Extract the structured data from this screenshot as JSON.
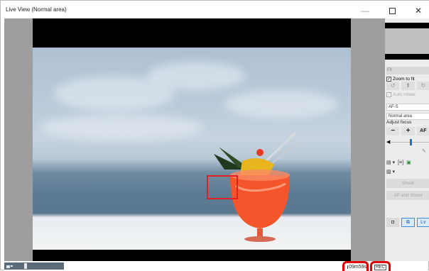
{
  "window": {
    "title": "Live View (Normal area)",
    "minimize_glyph": "—",
    "close_glyph": "✕"
  },
  "status": {
    "timer": "09m59s",
    "rec_label": "REC"
  },
  "panel": {
    "fit_label": "Fit",
    "zoom_to_fit": "Zoom to fit",
    "zoom_to_fit_checked": true,
    "auto_rotate": "Auto rotate",
    "auto_rotate_checked": true,
    "rotate_left_icon": "↺",
    "rotate_up_icon": "⬆",
    "rotate_right_icon": "↻",
    "af_mode": "AF-S",
    "af_area": "Normal area",
    "adjust_focus_label": "Adjust focus",
    "focus_minus": "−",
    "focus_plus": "+",
    "af_button": "AF",
    "shoot_button": "Shoot",
    "af_and_shoot_button": "AF and Shoot",
    "mode_lv": "Lv"
  },
  "colors": {
    "accent_red": "#e00000",
    "focus_box": "#e02020",
    "active_blue": "#3c8de0"
  }
}
